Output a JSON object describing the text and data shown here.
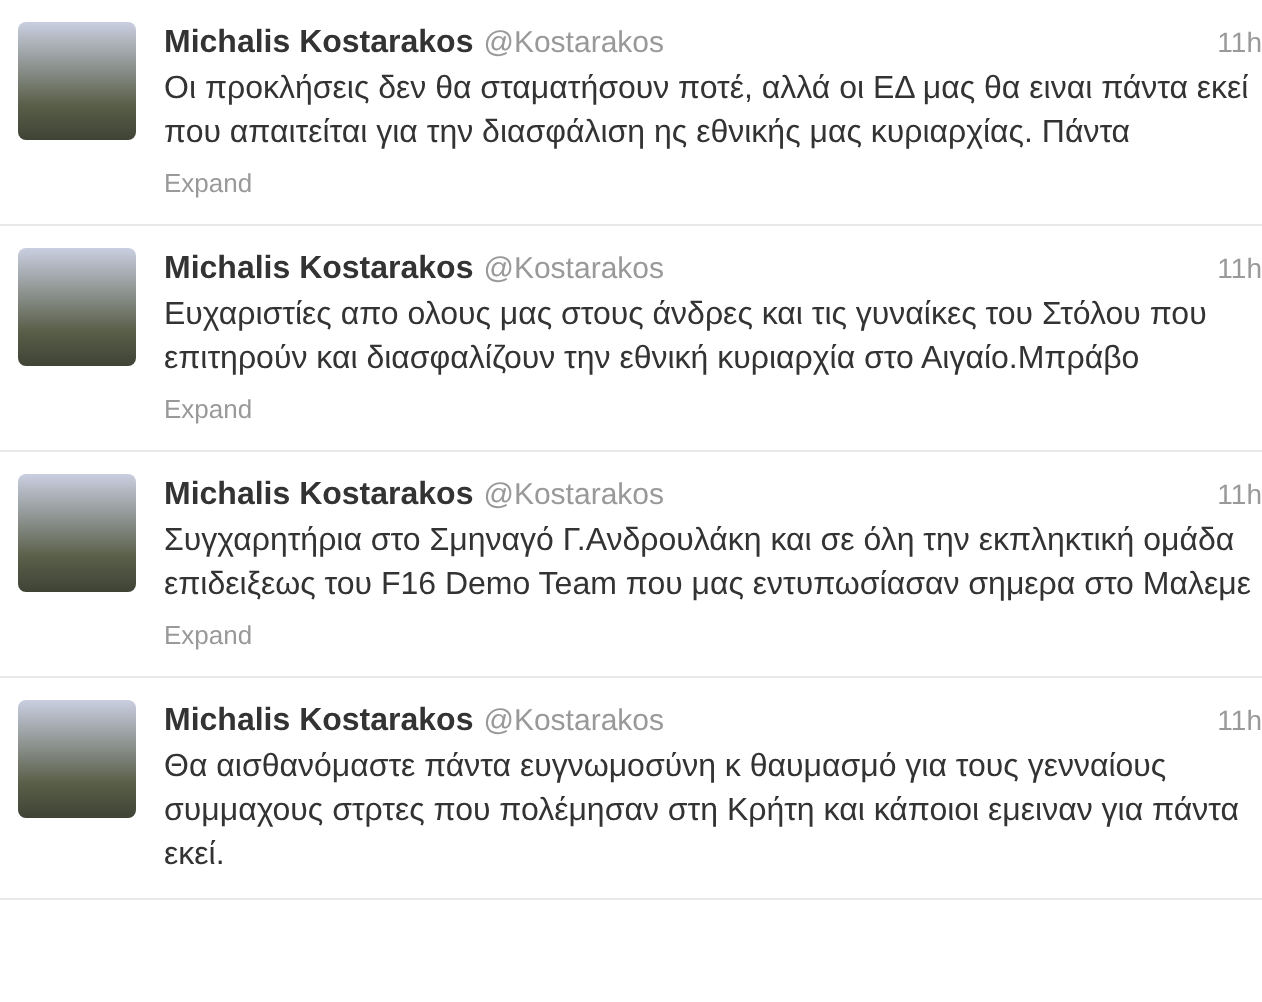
{
  "tweets": [
    {
      "name": "Michalis Kostarakos",
      "handle": "@Kostarakos",
      "time": "11h",
      "text": "Οι προκλήσεις δεν θα σταματήσουν ποτέ, αλλά οι ΕΔ μας θα ειναι πάντα εκεί που απαιτείται για την διασφάλιση ης εθνικής μας κυριαρχίας. Πάντα",
      "expand": "Expand"
    },
    {
      "name": "Michalis Kostarakos",
      "handle": "@Kostarakos",
      "time": "11h",
      "text": "Ευχαριστίες απο ολους μας στους άνδρες και τις γυναίκες του Στόλου που επιτηρούν και διασφαλίζουν την εθνική κυριαρχία στο Αιγαίο.Μπράβο",
      "expand": "Expand"
    },
    {
      "name": "Michalis Kostarakos",
      "handle": "@Kostarakos",
      "time": "11h",
      "text": "Συγχαρητήρια στο Σμηναγό Γ.Ανδρουλάκη και σε όλη την εκπληκτική ομάδα επιδειξεως του F16 Demo Team που μας εντυπωσίασαν σημερα στο Μαλεμε",
      "expand": "Expand"
    },
    {
      "name": "Michalis Kostarakos",
      "handle": "@Kostarakos",
      "time": "11h",
      "text": "Θα αισθανόμαστε πάντα ευγνωμοσύνη κ θαυμασμό για τους γενναίους συμμαχους στρτες που πολέμησαν στη Κρήτη και κάποιοι εμειναν για πάντα εκεί."
    }
  ]
}
